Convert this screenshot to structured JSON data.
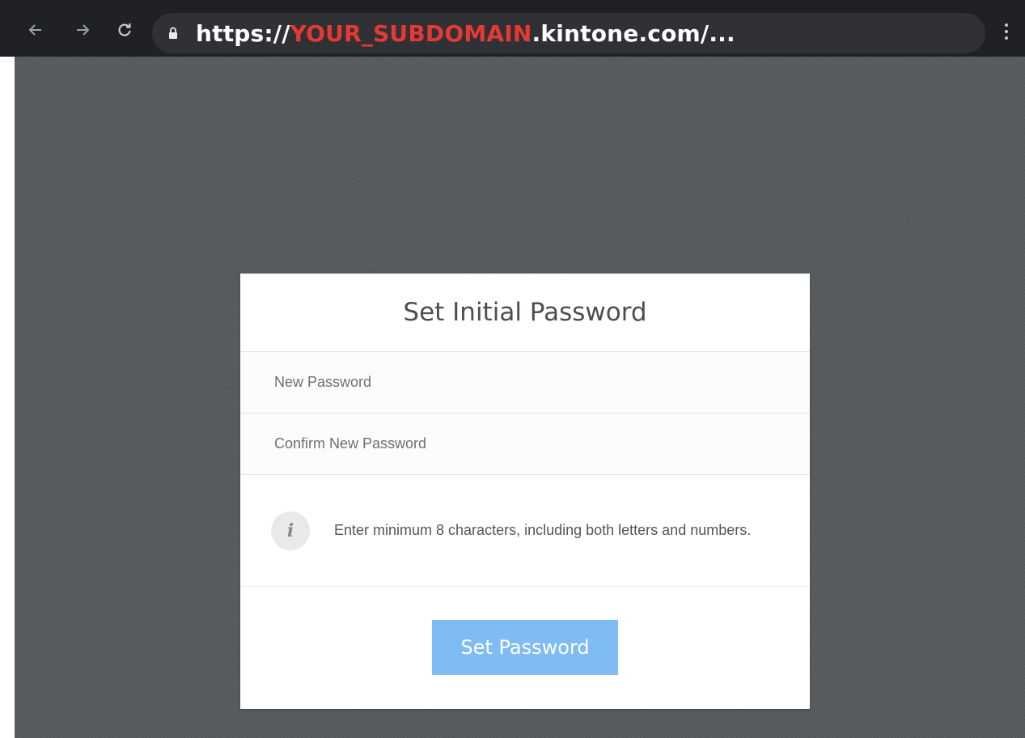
{
  "browser": {
    "url_prefix": "https://",
    "url_subdomain": "YOUR_SUBDOMAIN",
    "url_suffix": ".kintone.com/...",
    "icons": {
      "back": "arrow-left-icon",
      "forward": "arrow-right-icon",
      "reload": "reload-icon",
      "lock": "lock-icon",
      "menu": "kebab-menu-icon"
    }
  },
  "form": {
    "title": "Set Initial Password",
    "new_password_placeholder": "New Password",
    "confirm_password_placeholder": "Confirm New Password",
    "note": "Enter minimum 8 characters, including both letters and numbers.",
    "info_glyph": "i",
    "submit_label": "Set Password"
  },
  "colors": {
    "url_subdomain": "#e53935",
    "submit_button": "#7fbcf4",
    "background": "#555a5d",
    "toolbar": "#202124"
  }
}
